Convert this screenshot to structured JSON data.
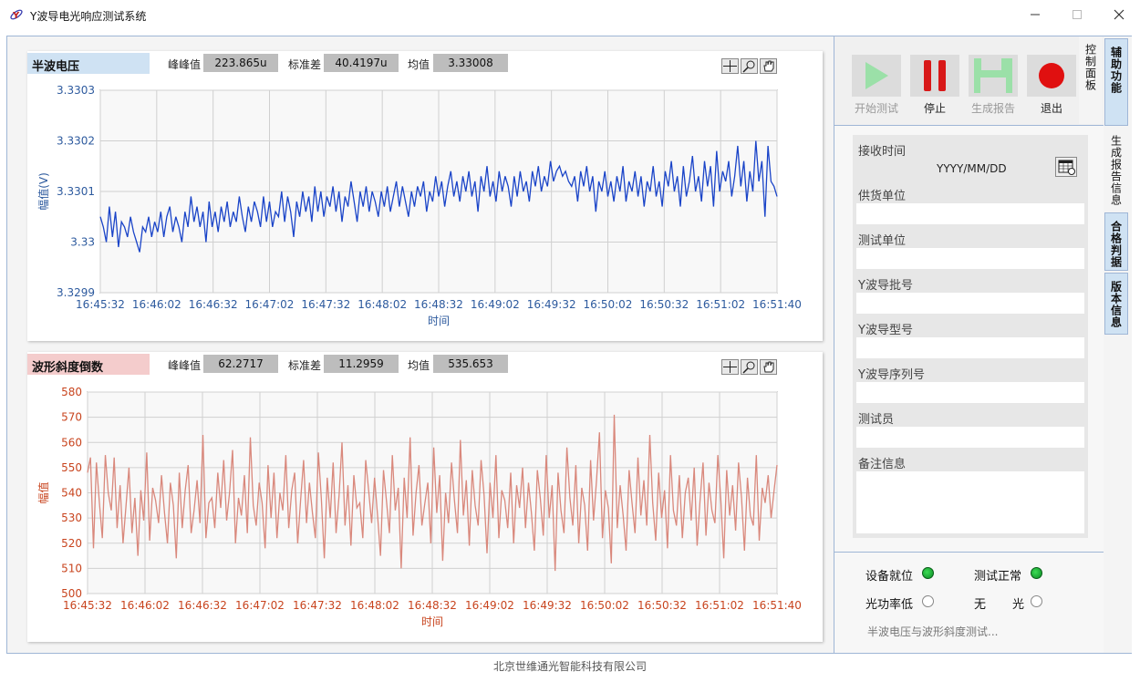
{
  "window": {
    "title": "Y波导电光响应测试系统"
  },
  "footer": "北京世维通光智能科技有限公司",
  "charts": {
    "top": {
      "title": "半波电压",
      "stats": [
        {
          "label": "峰峰值",
          "value": "223.865u"
        },
        {
          "label": "标准差",
          "value": "40.4197u"
        },
        {
          "label": "均值",
          "value": "3.33008"
        }
      ],
      "ylabel": "幅值(V)",
      "xlabel": "时间",
      "color": "#1a44c8"
    },
    "bottom": {
      "title": "波形斜度倒数",
      "stats": [
        {
          "label": "峰峰值",
          "value": "62.2717"
        },
        {
          "label": "标准差",
          "value": "11.2959"
        },
        {
          "label": "均值",
          "value": "535.653"
        }
      ],
      "ylabel": "幅值",
      "xlabel": "时间",
      "color": "#d9887c"
    }
  },
  "chart_data": [
    {
      "type": "line",
      "title": "半波电压",
      "xlabel": "时间",
      "ylabel": "幅值(V)",
      "ylim": [
        3.3299,
        3.3303
      ],
      "xlim": [
        "16:45:32",
        "16:51:40"
      ],
      "y_ticks": [
        "3.3303",
        "3.3302",
        "3.3301",
        "3.33",
        "3.3299"
      ],
      "x_ticks": [
        "16:45:32",
        "16:46:02",
        "16:46:32",
        "16:47:02",
        "16:47:32",
        "16:48:02",
        "16:48:32",
        "16:49:02",
        "16:49:32",
        "16:50:02",
        "16:50:32",
        "16:51:02",
        "16:51:40"
      ],
      "grid": true,
      "series": [
        {
          "values": [
            3.33005,
            3.33003,
            3.33,
            3.33007,
            3.33001,
            3.33006,
            3.32999,
            3.33004,
            3.33003,
            3.33001,
            3.33005,
            3.33002,
            3.33,
            3.32998,
            3.33003,
            3.33002,
            3.33005,
            3.33001,
            3.33004,
            3.33002,
            3.33006,
            3.33001,
            3.33005,
            3.33007,
            3.33002,
            3.33005,
            3.33003,
            3.33,
            3.33006,
            3.33003,
            3.33009,
            3.33004,
            3.33007,
            3.33003,
            3.33006,
            3.33,
            3.33008,
            3.33003,
            3.33006,
            3.33002,
            3.33007,
            3.33004,
            3.33008,
            3.33003,
            3.33006,
            3.33004,
            3.33009,
            3.33005,
            3.33002,
            3.33007,
            3.33004,
            3.33008,
            3.33006,
            3.33003,
            3.33009,
            3.33004,
            3.33008,
            3.33003,
            3.33006,
            3.33005,
            3.3301,
            3.33004,
            3.33009,
            3.33006,
            3.33001,
            3.33008,
            3.33005,
            3.3301,
            3.33006,
            3.33009,
            3.33004,
            3.33011,
            3.33006,
            3.3301,
            3.33005,
            3.33009,
            3.33007,
            3.33011,
            3.33006,
            3.3301,
            3.33004,
            3.33009,
            3.33007,
            3.33012,
            3.33008,
            3.33004,
            3.3301,
            3.33007,
            3.33011,
            3.33006,
            3.3301,
            3.33008,
            3.33005,
            3.3301,
            3.33007,
            3.33011,
            3.33006,
            3.33009,
            3.33012,
            3.33007,
            3.33011,
            3.33008,
            3.33005,
            3.3301,
            3.33007,
            3.33011,
            3.33009,
            3.33012,
            3.33006,
            3.3301,
            3.33008,
            3.33013,
            3.33009,
            3.33012,
            3.33007,
            3.33011,
            3.33014,
            3.33009,
            3.33012,
            3.33008,
            3.33013,
            3.3301,
            3.33014,
            3.33009,
            3.33012,
            3.33006,
            3.33013,
            3.3301,
            3.33015,
            3.33009,
            3.33012,
            3.33008,
            3.33014,
            3.3301,
            3.33013,
            3.33011,
            3.33007,
            3.33013,
            3.33009,
            3.33014,
            3.3301,
            3.33012,
            3.33008,
            3.33014,
            3.33011,
            3.33015,
            3.3301,
            3.33013,
            3.33011,
            3.33016,
            3.33012,
            3.33014,
            3.33015,
            3.33013,
            3.33014,
            3.33012,
            3.33011,
            3.33013,
            3.33008,
            3.33014,
            3.33011,
            3.33015,
            3.3301,
            3.33013,
            3.33006,
            3.33012,
            3.3301,
            3.33014,
            3.33009,
            3.33012,
            3.33008,
            3.33013,
            3.3301,
            3.33015,
            3.33008,
            3.33012,
            3.3301,
            3.33014,
            3.33009,
            3.33013,
            3.33007,
            3.33012,
            3.3301,
            3.33015,
            3.33009,
            3.33012,
            3.33007,
            3.33014,
            3.33011,
            3.33016,
            3.3301,
            3.33013,
            3.33007,
            3.33015,
            3.33009,
            3.33012,
            3.33017,
            3.3301,
            3.33013,
            3.33008,
            3.33016,
            3.33011,
            3.33015,
            3.33007,
            3.33018,
            3.3301,
            3.33014,
            3.33012,
            3.33016,
            3.33009,
            3.33013,
            3.33019,
            3.33011,
            3.33016,
            3.33008,
            3.33014,
            3.3301,
            3.3302,
            3.33012,
            3.33016,
            3.33005,
            3.33019,
            3.33012,
            3.33011,
            3.33009
          ]
        }
      ]
    },
    {
      "type": "line",
      "title": "波形斜度倒数",
      "xlabel": "时间",
      "ylabel": "幅值",
      "ylim": [
        500,
        580
      ],
      "xlim": [
        "16:45:32",
        "16:51:40"
      ],
      "y_ticks": [
        "580",
        "570",
        "560",
        "550",
        "540",
        "530",
        "520",
        "510",
        "500"
      ],
      "x_ticks": [
        "16:45:32",
        "16:46:02",
        "16:46:32",
        "16:47:02",
        "16:47:32",
        "16:48:02",
        "16:48:32",
        "16:49:02",
        "16:49:32",
        "16:50:02",
        "16:50:32",
        "16:51:02",
        "16:51:40"
      ],
      "grid": true,
      "series": [
        {
          "values": [
            548,
            554,
            518,
            552,
            536,
            522,
            555,
            540,
            533,
            554,
            526,
            543,
            520,
            535,
            550,
            524,
            538,
            515,
            541,
            529,
            556,
            521,
            542,
            537,
            528,
            547,
            532,
            520,
            544,
            535,
            514,
            548,
            526,
            541,
            551,
            524,
            533,
            545,
            528,
            563,
            522,
            536,
            538,
            526,
            548,
            534,
            553,
            529,
            540,
            557,
            520,
            538,
            531,
            547,
            524,
            562,
            535,
            527,
            544,
            536,
            518,
            551,
            530,
            548,
            522,
            540,
            533,
            555,
            526,
            541,
            548,
            520,
            537,
            553,
            528,
            544,
            532,
            522,
            556,
            538,
            514,
            546,
            530,
            552,
            524,
            539,
            560,
            527,
            543,
            519,
            547,
            534,
            536,
            522,
            553,
            541,
            528,
            546,
            531,
            515,
            549,
            537,
            524,
            555,
            533,
            542,
            510,
            546,
            530,
            562,
            523,
            540,
            551,
            527,
            536,
            544,
            520,
            558,
            532,
            547,
            513,
            540,
            528,
            552,
            537,
            524,
            561,
            531,
            545,
            519,
            549,
            535,
            527,
            553,
            539,
            516,
            544,
            530,
            555,
            522,
            541,
            537,
            526,
            548,
            520,
            543,
            534,
            550,
            526,
            544,
            532,
            517,
            549,
            538,
            523,
            555,
            530,
            543,
            509,
            548,
            533,
            524,
            558,
            538,
            527,
            551,
            520,
            542,
            535,
            517,
            553,
            529,
            545,
            564,
            522,
            541,
            534,
            512,
            571,
            526,
            543,
            531,
            517,
            549,
            536,
            524,
            554,
            531,
            545,
            527,
            563,
            536,
            521,
            548,
            530,
            541,
            518,
            555,
            533,
            527,
            547,
            522,
            540,
            546,
            529,
            550,
            519,
            537,
            552,
            523,
            544,
            533,
            528,
            555,
            537,
            514,
            549,
            531,
            543,
            525,
            552,
            538,
            517,
            546,
            531,
            527,
            555,
            521,
            542,
            536,
            547,
            530,
            541,
            551
          ]
        }
      ]
    }
  ],
  "toolbar": {
    "start": "开始测试",
    "stop": "停止",
    "report": "生成报告",
    "exit": "退出"
  },
  "form": {
    "receive_time_label": "接收时间",
    "date_placeholder": "YYYY/MM/DD",
    "supplier_label": "供货单位",
    "test_unit_label": "测试单位",
    "batch_label": "Y波导批号",
    "model_label": "Y波导型号",
    "serial_label": "Y波导序列号",
    "tester_label": "测试员",
    "remark_label": "备注信息"
  },
  "status": {
    "device_ready": "设备就位",
    "test_normal": "测试正常",
    "low_power": "光功率低",
    "no": "无",
    "light": "光",
    "message": "半波电压与波形斜度测试..."
  },
  "side_tabs": {
    "control_panel": "控制面板",
    "arrow": ">",
    "aux": "辅助功能",
    "report_info": "生成报告信息",
    "pass_criteria": "合格判据",
    "version": "版本信息"
  },
  "colors": {
    "top_series": "#1a44c8",
    "bottom_series": "#d9887c",
    "led_on": "#0b8a24"
  }
}
